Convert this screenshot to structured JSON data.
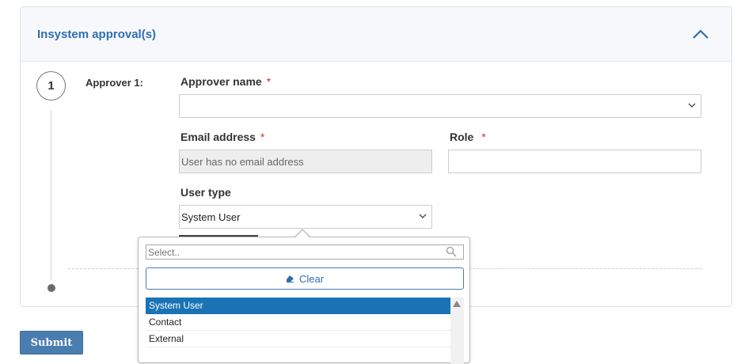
{
  "panel": {
    "title": "Insystem approval(s)",
    "collapse_icon": "chevron-up-icon"
  },
  "step": {
    "number": "1",
    "approver_label": "Approver 1:"
  },
  "fields": {
    "approver_name": {
      "label": "Approver name",
      "required": "*",
      "value": ""
    },
    "email": {
      "label": "Email address",
      "required": "*",
      "value": "User has no email address"
    },
    "role": {
      "label": "Role",
      "required": "*",
      "value": ""
    },
    "user_type": {
      "label": "User type",
      "value": "System User"
    }
  },
  "dropdown": {
    "search_placeholder": "Select..",
    "clear_label": "Clear",
    "options": [
      "System User",
      "Contact",
      "External"
    ],
    "selected": "System User"
  },
  "submit_label": "Submit",
  "colors": {
    "accent": "#2e6fb0",
    "selected": "#1a73b5",
    "button": "#4a7db0",
    "required": "#c0392b"
  }
}
